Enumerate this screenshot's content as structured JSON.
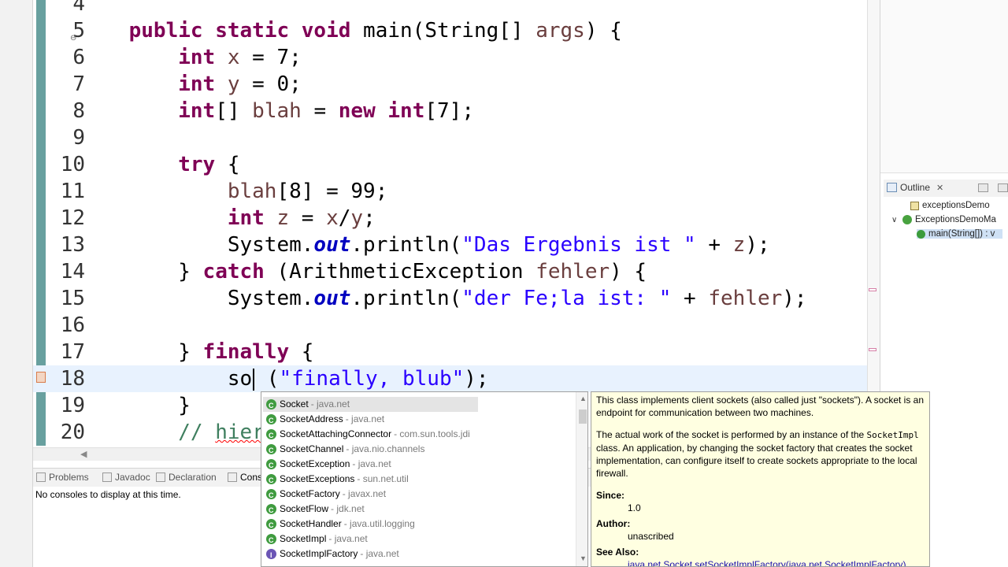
{
  "editor": {
    "lines": [
      {
        "n": "4",
        "segs": []
      },
      {
        "n": "5",
        "segs": [
          [
            "    ",
            ""
          ],
          [
            "public",
            "kw"
          ],
          [
            " ",
            ""
          ],
          [
            "static",
            "kw"
          ],
          [
            " ",
            ""
          ],
          [
            "void",
            "kw"
          ],
          [
            " main(String[] ",
            ""
          ],
          [
            "args",
            "var"
          ],
          [
            ") {",
            ""
          ]
        ]
      },
      {
        "n": "6",
        "segs": [
          [
            "        ",
            ""
          ],
          [
            "int",
            "kw"
          ],
          [
            " ",
            ""
          ],
          [
            "x",
            "var"
          ],
          [
            " = 7;",
            ""
          ]
        ]
      },
      {
        "n": "7",
        "segs": [
          [
            "        ",
            ""
          ],
          [
            "int",
            "kw"
          ],
          [
            " ",
            ""
          ],
          [
            "y",
            "var"
          ],
          [
            " = 0;",
            ""
          ]
        ]
      },
      {
        "n": "8",
        "segs": [
          [
            "        ",
            ""
          ],
          [
            "int",
            "kw"
          ],
          [
            "[] ",
            ""
          ],
          [
            "blah",
            "var"
          ],
          [
            " = ",
            ""
          ],
          [
            "new",
            "kw"
          ],
          [
            " ",
            ""
          ],
          [
            "int",
            "kw"
          ],
          [
            "[7];",
            ""
          ]
        ]
      },
      {
        "n": "9",
        "segs": []
      },
      {
        "n": "10",
        "segs": [
          [
            "        ",
            ""
          ],
          [
            "try",
            "kw"
          ],
          [
            " {",
            ""
          ]
        ]
      },
      {
        "n": "11",
        "segs": [
          [
            "            ",
            ""
          ],
          [
            "blah",
            "var"
          ],
          [
            "[8] = 99;",
            ""
          ]
        ]
      },
      {
        "n": "12",
        "segs": [
          [
            "            ",
            ""
          ],
          [
            "int",
            "kw"
          ],
          [
            " ",
            ""
          ],
          [
            "z",
            "var"
          ],
          [
            " = ",
            ""
          ],
          [
            "x",
            "var"
          ],
          [
            "/",
            ""
          ],
          [
            "y",
            "var"
          ],
          [
            ";",
            ""
          ]
        ]
      },
      {
        "n": "13",
        "segs": [
          [
            "            System.",
            ""
          ],
          [
            "out",
            "fld"
          ],
          [
            ".println(",
            ""
          ],
          [
            "\"Das Ergebnis ist \"",
            "str"
          ],
          [
            " + ",
            ""
          ],
          [
            "z",
            "var"
          ],
          [
            ");",
            ""
          ]
        ]
      },
      {
        "n": "14",
        "segs": [
          [
            "        } ",
            ""
          ],
          [
            "catch",
            "kw"
          ],
          [
            " (ArithmeticException ",
            ""
          ],
          [
            "fehler",
            "var"
          ],
          [
            ") {",
            ""
          ]
        ]
      },
      {
        "n": "15",
        "segs": [
          [
            "            System.",
            ""
          ],
          [
            "out",
            "fld"
          ],
          [
            ".println(",
            ""
          ],
          [
            "\"der Fe;la ist: \"",
            "str"
          ],
          [
            " + ",
            ""
          ],
          [
            "fehler",
            "var"
          ],
          [
            ");",
            ""
          ]
        ]
      },
      {
        "n": "16",
        "segs": []
      },
      {
        "n": "17",
        "segs": [
          [
            "        } ",
            ""
          ],
          [
            "finally",
            "kw"
          ],
          [
            " {",
            ""
          ]
        ]
      },
      {
        "n": "18",
        "segs": [
          [
            "            so",
            ""
          ],
          [
            "CARET",
            ""
          ],
          [
            " (",
            ""
          ],
          [
            "\"finally, blub\"",
            "str"
          ],
          [
            ");",
            ""
          ]
        ],
        "current": true
      },
      {
        "n": "19",
        "segs": [
          [
            "        }",
            ""
          ]
        ]
      },
      {
        "n": "20",
        "segs": [
          [
            "        ",
            ""
          ],
          [
            "// hier",
            "cmt-typo"
          ]
        ]
      }
    ]
  },
  "outline": {
    "tab_label": "Outline",
    "items": [
      {
        "label": "exceptionsDemo"
      },
      {
        "label": "ExceptionsDemoMa"
      },
      {
        "label": "main(String[]) : v"
      }
    ]
  },
  "bottom": {
    "tabs": [
      "Problems",
      "Javadoc",
      "Declaration",
      "Cons"
    ],
    "console_message": "No consoles to display at this time."
  },
  "assist": {
    "proposals": [
      {
        "name": "Socket",
        "pkg": "java.net",
        "kind": "class"
      },
      {
        "name": "SocketAddress",
        "pkg": "java.net",
        "kind": "class"
      },
      {
        "name": "SocketAttachingConnector",
        "pkg": "com.sun.tools.jdi",
        "kind": "class"
      },
      {
        "name": "SocketChannel",
        "pkg": "java.nio.channels",
        "kind": "class"
      },
      {
        "name": "SocketException",
        "pkg": "java.net",
        "kind": "class"
      },
      {
        "name": "SocketExceptions",
        "pkg": "sun.net.util",
        "kind": "class"
      },
      {
        "name": "SocketFactory",
        "pkg": "javax.net",
        "kind": "class"
      },
      {
        "name": "SocketFlow",
        "pkg": "jdk.net",
        "kind": "class"
      },
      {
        "name": "SocketHandler",
        "pkg": "java.util.logging",
        "kind": "class"
      },
      {
        "name": "SocketImpl",
        "pkg": "java.net",
        "kind": "class"
      },
      {
        "name": "SocketImplFactory",
        "pkg": "java.net",
        "kind": "interface"
      }
    ],
    "selected_index": 0
  },
  "javadoc": {
    "p1": "This class implements client sockets (also called just \"sockets\"). A socket is an endpoint for communication between two machines.",
    "p2_pre": "The actual work of the socket is performed by an instance of the",
    "p2_code": "SocketImpl",
    "p2_post": "class. An application, by changing the socket factory that creates the socket implementation, can configure itself to create sockets appropriate to the local firewall.",
    "since_label": "Since:",
    "since_value": "1.0",
    "author_label": "Author:",
    "author_value": "unascribed",
    "see_label": "See Also:",
    "see_link": "java.net.Socket.setSocketImplFactory(java.net.SocketImplFactory)"
  }
}
